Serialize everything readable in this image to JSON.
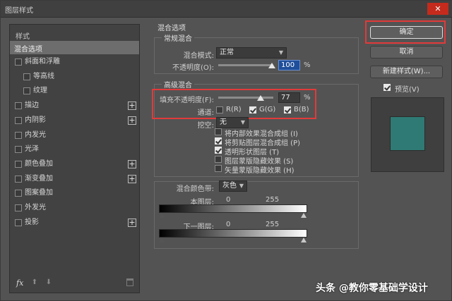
{
  "window": {
    "title": "图层样式",
    "close_glyph": "✕"
  },
  "left_panel": {
    "header": "样式",
    "selected": "混合选项",
    "items": [
      {
        "label": "斜面和浮雕",
        "checked": false,
        "sub": false,
        "plus": false
      },
      {
        "label": "等高线",
        "checked": false,
        "sub": true,
        "plus": false
      },
      {
        "label": "纹理",
        "checked": false,
        "sub": true,
        "plus": false
      },
      {
        "label": "描边",
        "checked": false,
        "sub": false,
        "plus": true
      },
      {
        "label": "内阴影",
        "checked": false,
        "sub": false,
        "plus": true
      },
      {
        "label": "内发光",
        "checked": false,
        "sub": false,
        "plus": false
      },
      {
        "label": "光泽",
        "checked": false,
        "sub": false,
        "plus": false
      },
      {
        "label": "颜色叠加",
        "checked": false,
        "sub": false,
        "plus": true
      },
      {
        "label": "渐变叠加",
        "checked": false,
        "sub": false,
        "plus": true
      },
      {
        "label": "图案叠加",
        "checked": false,
        "sub": false,
        "plus": false
      },
      {
        "label": "外发光",
        "checked": false,
        "sub": false,
        "plus": false
      },
      {
        "label": "投影",
        "checked": false,
        "sub": false,
        "plus": true
      }
    ],
    "plus_glyph": "+",
    "footer": {
      "fx": "fx",
      "up": "⬆",
      "down": "⬇"
    }
  },
  "blend_options": {
    "title": "混合选项",
    "general": {
      "title": "常规混合",
      "mode_label": "混合模式:",
      "mode_value": "正常",
      "opacity_label": "不透明度(O):",
      "opacity_value": "100",
      "opacity_unit": "%"
    },
    "advanced": {
      "title": "高级混合",
      "fill_label": "填充不透明度(F):",
      "fill_value": "77",
      "fill_unit": "%",
      "channels_label": "通道:",
      "channels": [
        {
          "label": "R(R)",
          "checked": false
        },
        {
          "label": "G(G)",
          "checked": true
        },
        {
          "label": "B(B)",
          "checked": true
        }
      ],
      "knockout_label": "挖空:",
      "knockout_value": "无",
      "options": [
        {
          "label": "将内部效果混合成组 (I)",
          "checked": false
        },
        {
          "label": "将剪贴图层混合成组 (P)",
          "checked": true
        },
        {
          "label": "透明形状图层 (T)",
          "checked": true
        },
        {
          "label": "图层蒙版隐藏效果 (S)",
          "checked": false
        },
        {
          "label": "矢量蒙版隐藏效果 (H)",
          "checked": false
        }
      ]
    },
    "blend_if": {
      "label": "混合颜色带:",
      "value": "灰色",
      "this_layer_label": "本图层:",
      "this_layer_min": "0",
      "this_layer_max": "255",
      "underlying_label": "下一图层:",
      "underlying_min": "0",
      "underlying_max": "255"
    }
  },
  "buttons": {
    "ok": "确定",
    "cancel": "取消",
    "new_style": "新建样式(W)...",
    "preview_label": "预览(V)",
    "preview_checked": true
  },
  "preview": {
    "swatch_color": "#2f7a74"
  },
  "watermark": "头条 @教你零基础学设计"
}
